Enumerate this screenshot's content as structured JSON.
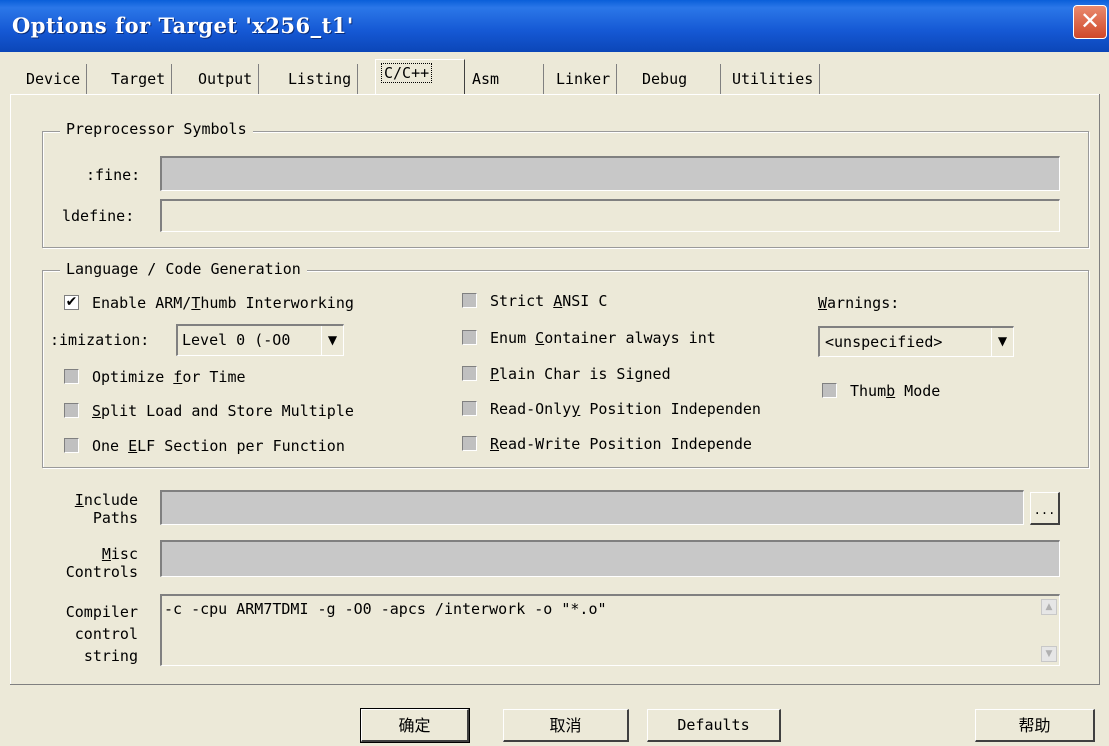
{
  "window": {
    "title": "Options for Target 'x256_t1'",
    "close_glyph": "✕"
  },
  "tabs": [
    {
      "label": "Device"
    },
    {
      "label": "Target"
    },
    {
      "label": "Output"
    },
    {
      "label": "Listing"
    },
    {
      "label": "C/C++",
      "active": true
    },
    {
      "label": "Asm"
    },
    {
      "label": "Linker"
    },
    {
      "label": "Debug"
    },
    {
      "label": "Utilities"
    }
  ],
  "preprocessor": {
    "title": "Preprocessor Symbols",
    "define_label": ":fine:",
    "define_value": "",
    "undefine_label": "ldefine:",
    "undefine_value": ""
  },
  "codegen": {
    "title": "Language / Code Generation",
    "enable_interworking": {
      "label_pre": "Enable ARM/",
      "label_u": "T",
      "label_post": "humb Interworking",
      "checked": true
    },
    "optimization_label": ":imization:",
    "optimization_value": "Level 0 (-O0",
    "optimize_time": {
      "label_pre": "Optimize ",
      "label_u": "f",
      "label_post": "or Time",
      "checked": false
    },
    "split_load": {
      "label_pre": "",
      "label_u": "S",
      "label_post": "plit Load and Store Multiple",
      "checked": false
    },
    "one_elf": {
      "label_pre": "One ",
      "label_u": "E",
      "label_post": "LF Section per Function",
      "checked": false
    },
    "strict_ansi": {
      "label_pre": "Strict ",
      "label_u": "A",
      "label_post": "NSI C",
      "checked": false
    },
    "enum_container": {
      "label_pre": "Enum ",
      "label_u": "C",
      "label_post": "ontainer always int",
      "checked": false
    },
    "plain_char": {
      "label_pre": "",
      "label_u": "P",
      "label_post": "lain Char is Signed",
      "checked": false
    },
    "ro_position": {
      "label_pre": "Read-Only",
      "label_u": "y",
      "label_post": " Position Independen",
      "checked": false
    },
    "rw_position": {
      "label_pre": "",
      "label_u": "R",
      "label_post": "ead-Write Position Independe",
      "checked": false
    },
    "warnings_label_u": "W",
    "warnings_label_post": "arnings:",
    "warnings_value": "<unspecified>",
    "thumb_mode": {
      "label_pre": "Thum",
      "label_u": "b",
      "label_post": " Mode",
      "checked": false
    }
  },
  "include_paths": {
    "label_u": "I",
    "label_line1": "nclude",
    "label_line2": "Paths",
    "value": "",
    "browse": "..."
  },
  "misc_controls": {
    "label_u": "M",
    "label_line1": "isc",
    "label_line2": "Controls",
    "value": ""
  },
  "compiler_string": {
    "label_line1": "Compiler",
    "label_line2": "control",
    "label_line3": "string",
    "value": "-c -cpu ARM7TDMI -g -O0 -apcs /interwork -o \"*.o\""
  },
  "buttons": {
    "ok": "确定",
    "cancel": "取消",
    "defaults": "Defaults",
    "help": "帮助"
  },
  "icons": {
    "scroll_up": "▲",
    "scroll_down": "▼",
    "combo_arrow": "▼",
    "check": "✔"
  }
}
